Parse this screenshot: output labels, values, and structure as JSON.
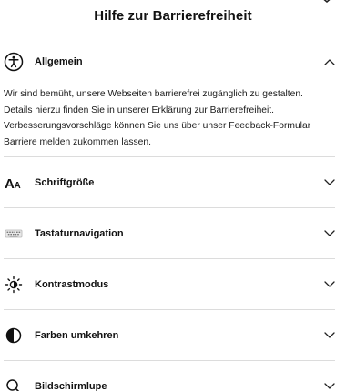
{
  "header": {
    "title": "Hilfe zur Barrierefreiheit"
  },
  "sections": [
    {
      "label": "Allgemein",
      "icon": "accessibility-icon",
      "expanded": true
    },
    {
      "label": "Schriftgröße",
      "icon": "font-size-icon",
      "expanded": false
    },
    {
      "label": "Tastaturnavigation",
      "icon": "keyboard-icon",
      "expanded": false
    },
    {
      "label": "Kontrastmodus",
      "icon": "brightness-icon",
      "expanded": false
    },
    {
      "label": "Farben umkehren",
      "icon": "invert-colors-icon",
      "expanded": false
    },
    {
      "label": "Bildschirmlupe",
      "icon": "magnifier-icon",
      "expanded": false
    }
  ],
  "general_text": "Wir sind bemüht, unsere Webseiten barrierefrei zugänglich zu gestalten. Details hierzu finden Sie in unserer Erklärung zur Barrierefreiheit. Verbesserungsvorschläge können Sie uns über unser Feedback-Formular Barriere melden zukommen lassen."
}
